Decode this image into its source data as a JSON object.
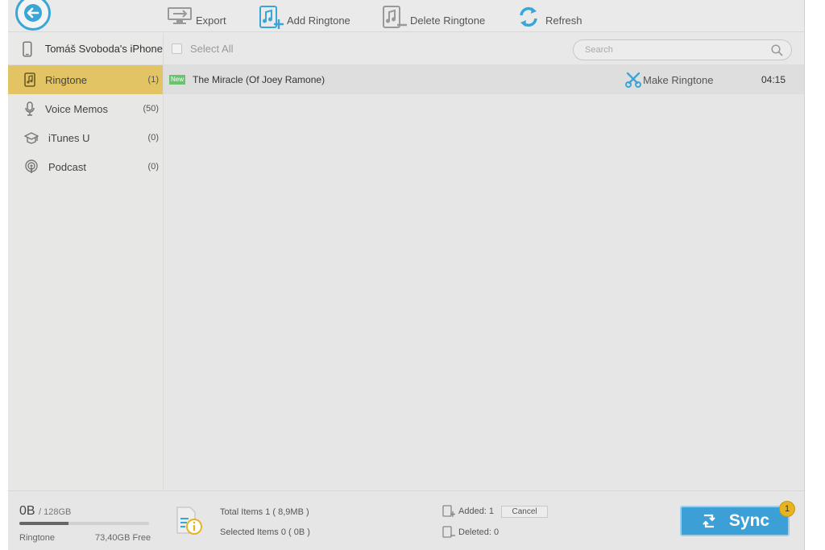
{
  "toolbar": {
    "export_label": "Export",
    "add_label": "Add Ringtone",
    "delete_label": "Delete Ringtone",
    "refresh_label": "Refresh"
  },
  "device": {
    "name": "Tomáš Svoboda's iPhone"
  },
  "sidebar": {
    "items": [
      {
        "label": "Ringtone",
        "count": "(1)",
        "icon": "ringtone-icon",
        "active": true
      },
      {
        "label": "Voice Memos",
        "count": "(50)",
        "icon": "microphone-icon",
        "active": false
      },
      {
        "label": "iTunes U",
        "count": "(0)",
        "icon": "graduation-cap-icon",
        "active": false
      },
      {
        "label": "Podcast",
        "count": "(0)",
        "icon": "podcast-icon",
        "active": false
      }
    ]
  },
  "list": {
    "select_all_label": "Select All",
    "search_placeholder": "Search",
    "rows": [
      {
        "badge": "New",
        "title": "The Miracle (Of Joey Ramone)",
        "action_label": "Make Ringtone",
        "duration": "04:15"
      }
    ]
  },
  "footer": {
    "used": "0B",
    "total": "/ 128GB",
    "used_fraction": 0.38,
    "category": "Ringtone",
    "free": "73,40GB Free",
    "total_items": "Total Items 1 ( 8,9MB )",
    "selected_items": "Selected Items 0 ( 0B )",
    "added_label": "Added: 1",
    "deleted_label": "Deleted: 0",
    "cancel_label": "Cancel",
    "sync_label": "Sync",
    "sync_badge": "1"
  },
  "colors": {
    "accent_blue": "#3aa6d8",
    "active_item": "#e2c465",
    "new_badge": "#6ac46e",
    "scissors": "#3aa6d8",
    "sync_badge": "#e6b422"
  }
}
